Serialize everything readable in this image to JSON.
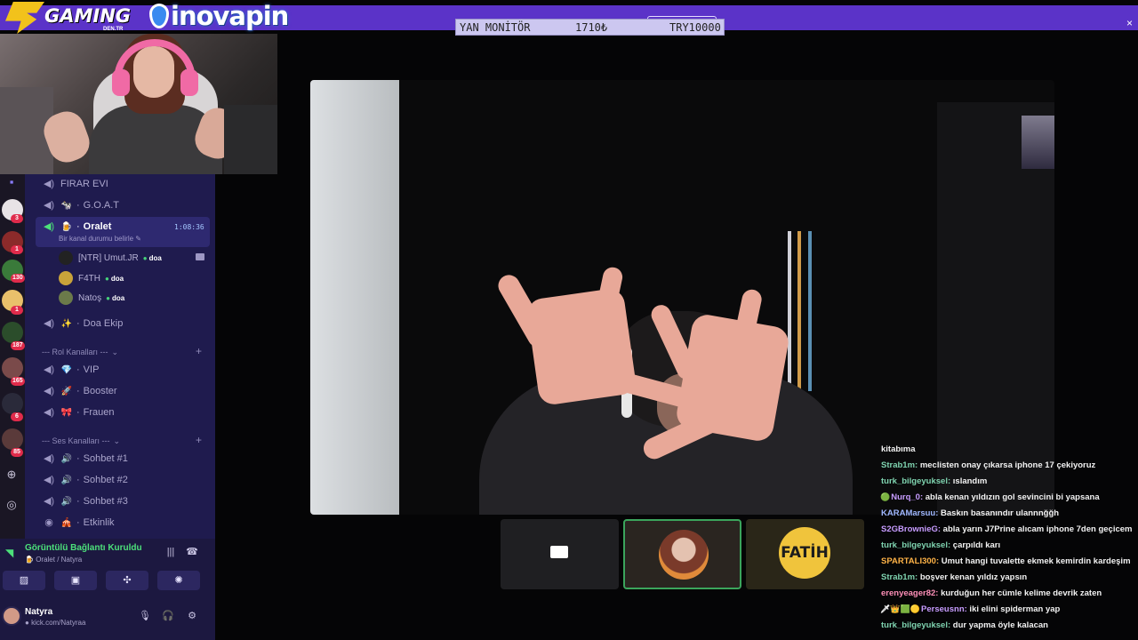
{
  "overlay": {
    "brand_left": "GAMING",
    "brand_left_sub": "DEN.TR",
    "brand_right": "inovapin",
    "banner_text": "Y...",
    "close_glyph": "×",
    "monitor": {
      "label": "YAN MONİTÖR",
      "price": "1710₺",
      "target": "TRY10000"
    }
  },
  "server_rail": {
    "badges": [
      "3",
      "1",
      "130",
      "1",
      "187",
      "165",
      "6",
      "85"
    ]
  },
  "sidebar": {
    "channels_top": [
      {
        "name": "FIRAR EVI",
        "emoji": ""
      },
      {
        "name": "G.O.A.T",
        "emoji": "🐄"
      }
    ],
    "active_channel": {
      "name": "Oralet",
      "emoji": "🍺",
      "timer": "1:08:36",
      "status": "Bir kanal durumu belirle"
    },
    "members": [
      {
        "name": "[NTR] Umut.JR",
        "tag": "doa"
      },
      {
        "name": "F4TH",
        "tag": "doa"
      },
      {
        "name": "Natoş",
        "tag": "doa"
      }
    ],
    "channel_doa": {
      "name": "Doa Ekip",
      "emoji": "✨"
    },
    "category_roles": "--- Rol Kanalları ---",
    "role_channels": [
      {
        "name": "VIP",
        "emoji": "💎"
      },
      {
        "name": "Booster",
        "emoji": "🚀"
      },
      {
        "name": "Frauen",
        "emoji": "🎀"
      }
    ],
    "category_voice": "--- Ses Kanalları ---",
    "voice_channels": [
      {
        "name": "Sohbet #1",
        "emoji": "🔊"
      },
      {
        "name": "Sohbet #2",
        "emoji": "🔊"
      },
      {
        "name": "Sohbet #3",
        "emoji": "🔊"
      },
      {
        "name": "Etkinlik",
        "emoji": "🎪"
      }
    ]
  },
  "voice_panel": {
    "status": "Görüntülü Bağlantı Kuruldu",
    "location": "Oralet / Natyra"
  },
  "user_panel": {
    "name": "Natyra",
    "subtitle": "kick.com/Natyraa"
  },
  "tiles": {
    "fatih_label": "FATİH"
  },
  "chat": {
    "messages": [
      {
        "user": "",
        "text": "kitabıma",
        "color": "#f2f2f2",
        "badges": ""
      },
      {
        "user": "Strab1m:",
        "text": " meclisten onay çıkarsa iphone 17 çekiyoruz",
        "color": "#7fd4b0",
        "badges": ""
      },
      {
        "user": "turk_bilgeyuksel:",
        "text": " ıslandım",
        "color": "#7fd4b0",
        "badges": ""
      },
      {
        "user": "Nurq_0:",
        "text": " abla kenan yıldızın gol sevincini bi yapsana",
        "color": "#c79cff",
        "badges": "🟢"
      },
      {
        "user": "KARAMarsuu:",
        "text": " Baskın basanındır ulannnğğh",
        "color": "#9fb7ff",
        "badges": ""
      },
      {
        "user": "S2GBrownieG:",
        "text": " abla yarın J7Prine alıcam iphone 7den geçicem",
        "color": "#c79cff",
        "badges": ""
      },
      {
        "user": "turk_bilgeyuksel:",
        "text": " çarpıldı karı",
        "color": "#7fd4b0",
        "badges": ""
      },
      {
        "user": "SPARTALI300:",
        "text": " Umut hangi tuvalette ekmek kemirdin kardeşim",
        "color": "#ffb347",
        "badges": ""
      },
      {
        "user": "Strab1m:",
        "text": " boşver kenan yıldız yapsın",
        "color": "#7fd4b0",
        "badges": ""
      },
      {
        "user": "erenyeager82:",
        "text": " kurduğun her cümle kelime devrik zaten",
        "color": "#ff8fb8",
        "badges": ""
      },
      {
        "user": "Perseusnn:",
        "text": " iki elini spiderman yap",
        "color": "#c79cff",
        "badges": "🗡👑🟩🟡"
      },
      {
        "user": "turk_bilgeyuksel:",
        "text": " dur yapma öyle kalacan",
        "color": "#7fd4b0",
        "badges": ""
      }
    ]
  },
  "colors": {
    "banner": "#5b33c8",
    "sidebar": "#1f1b4e",
    "connected": "#4ce07a",
    "speaking_border": "#3ba55c"
  }
}
